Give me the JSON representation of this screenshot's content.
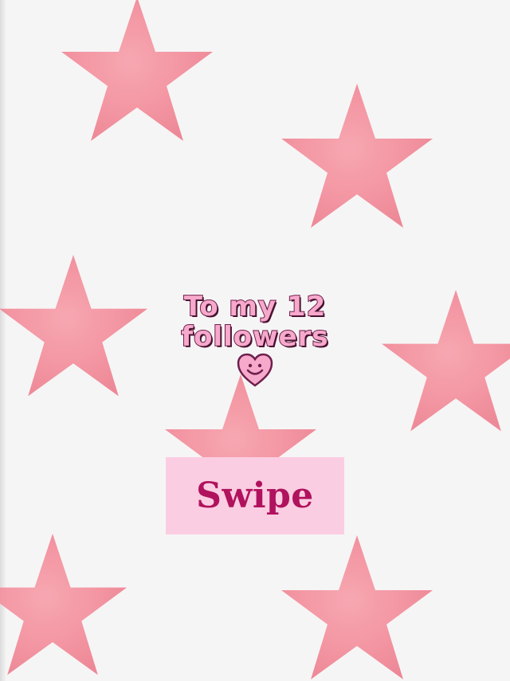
{
  "title": {
    "line1": "To my 12",
    "line2": "followers"
  },
  "swipe_label": "Swipe",
  "colors": {
    "background": "#f6f5f5",
    "star": "#f28b99",
    "title_fill": "#f7a9cb",
    "title_outline": "#6d1f4c",
    "swipe_box": "#fbcde2",
    "swipe_text": "#b0125e"
  },
  "icons": [
    "star-icon",
    "smiley-heart-icon"
  ]
}
